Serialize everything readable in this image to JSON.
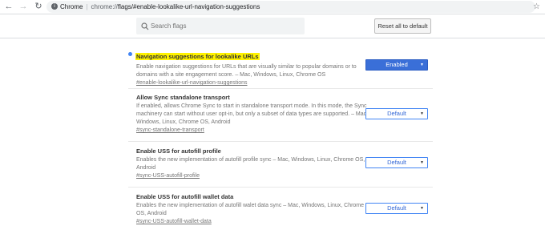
{
  "browser": {
    "chrome_label": "Chrome",
    "url_prefix": "chrome://",
    "url_path": "flags/#enable-lookalike-url-navigation-suggestions"
  },
  "header": {
    "search_placeholder": "Search flags",
    "reset_label": "Reset all to default"
  },
  "experiments": [
    {
      "title": "Navigation suggestions for lookalike URLs",
      "description": "Enable navigation suggestions for URLs that are visually similar to popular domains or to domains with a site engagement score. – Mac, Windows, Linux, Chrome OS",
      "link": "#enable-lookalike-url-navigation-suggestions",
      "value": "Enabled",
      "highlighted": true
    },
    {
      "title": "Allow Sync standalone transport",
      "description": "If enabled, allows Chrome Sync to start in standalone transport mode. In this mode, the Sync machinery can start without user opt-in, but only a subset of data types are supported. – Mac, Windows, Linux, Chrome OS, Android",
      "link": "#sync-standalone-transport",
      "value": "Default"
    },
    {
      "title": "Enable USS for autofill profile",
      "description": "Enables the new implementation of autofill profile sync – Mac, Windows, Linux, Chrome OS, Android",
      "link": "#sync-USS-autofill-profile",
      "value": "Default"
    },
    {
      "title": "Enable USS for autofill wallet data",
      "description": "Enables the new implementation of autofill walet data sync – Mac, Windows, Linux, Chrome OS, Android",
      "link": "#sync-USS-autofill-wallet-data",
      "value": "Default"
    }
  ],
  "colors": {
    "accent": "#4285f4",
    "enabled_bg": "#3a6fd8",
    "highlight": "#fff200"
  }
}
